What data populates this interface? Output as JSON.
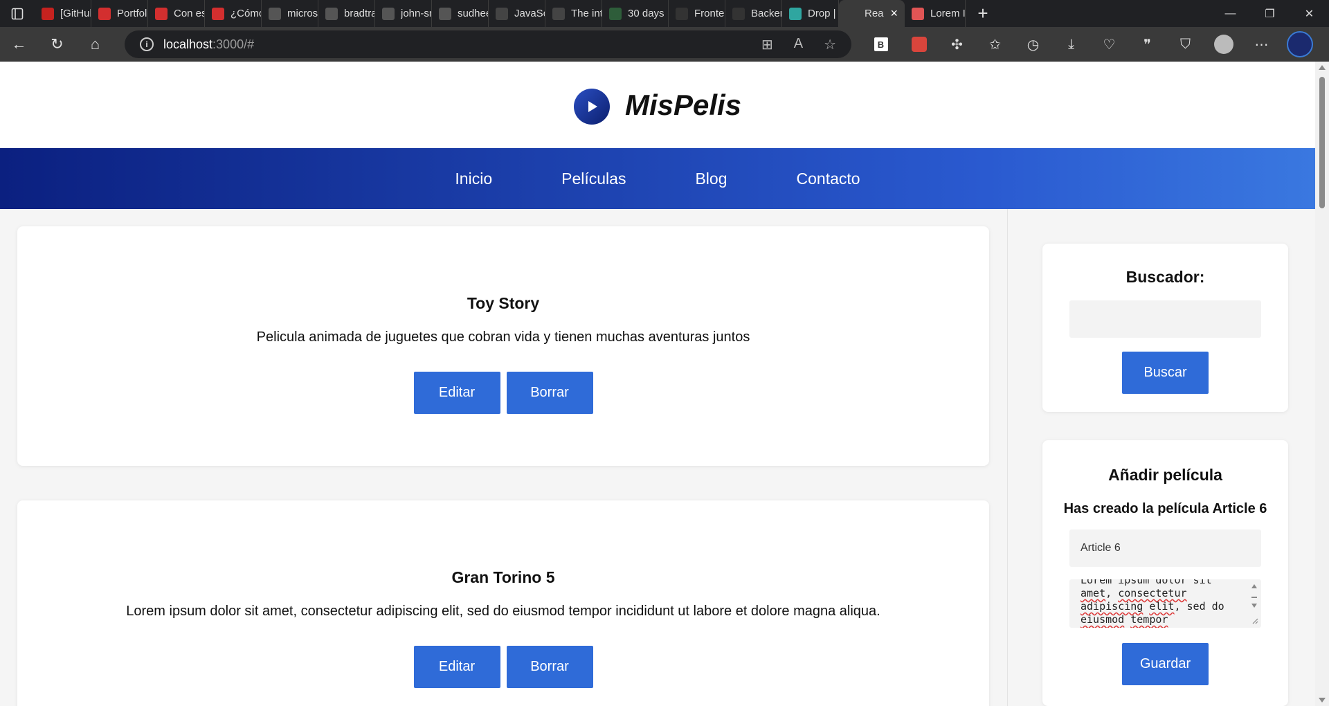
{
  "browser": {
    "tabs": [
      {
        "title": "[GitHub",
        "icon": "gmail-icon",
        "color": "#c5221f"
      },
      {
        "title": "Portfolio",
        "icon": "youtube-icon",
        "color": "#d32f2f"
      },
      {
        "title": "Con est",
        "icon": "youtube-icon",
        "color": "#d32f2f"
      },
      {
        "title": "¿Cómo",
        "icon": "youtube-icon",
        "color": "#d32f2f"
      },
      {
        "title": "microso",
        "icon": "github-icon",
        "color": "#555555"
      },
      {
        "title": "bradtra",
        "icon": "github-icon",
        "color": "#555555"
      },
      {
        "title": "john-sm",
        "icon": "github-icon",
        "color": "#555555"
      },
      {
        "title": "sudheer",
        "icon": "github-icon",
        "color": "#555555"
      },
      {
        "title": "JavaScri",
        "icon": "30-icon",
        "color": "#444444"
      },
      {
        "title": "The inte",
        "icon": "u-icon",
        "color": "#444444"
      },
      {
        "title": "30 days",
        "icon": "n-icon",
        "color": "#2e5d3a"
      },
      {
        "title": "Fronten",
        "icon": "r-icon",
        "color": "#333333"
      },
      {
        "title": "Backen",
        "icon": "r-icon",
        "color": "#333333"
      },
      {
        "title": "Drop | N",
        "icon": "diamond-icon",
        "color": "#2fa6a0"
      },
      {
        "title": "Rea",
        "icon": "react-icon",
        "color": "#3a3a3a",
        "active": true
      },
      {
        "title": "Lorem I",
        "icon": "lorem-icon",
        "color": "#e05555"
      }
    ],
    "url_host": "localhost",
    "url_path": ":3000/#"
  },
  "site": {
    "brand": "MisPelis",
    "nav": [
      "Inicio",
      "Películas",
      "Blog",
      "Contacto"
    ]
  },
  "articles": [
    {
      "title": "Toy Story",
      "description": "Pelicula animada de juguetes que cobran vida y tienen muchas aventuras juntos",
      "edit_label": "Editar",
      "delete_label": "Borrar"
    },
    {
      "title": "Gran Torino 5",
      "description": "Lorem ipsum dolor sit amet, consectetur adipiscing elit, sed do eiusmod tempor incididunt ut labore et dolore magna aliqua.",
      "edit_label": "Editar",
      "delete_label": "Borrar"
    }
  ],
  "search": {
    "heading": "Buscador:",
    "value": "",
    "button": "Buscar"
  },
  "add_movie": {
    "heading": "Añadir película",
    "status": "Has creado la película Article 6",
    "title_value": "Article 6",
    "description_lines": [
      "Lorem ipsum dolor sit",
      "amet, consectetur",
      "adipiscing elit, sed do",
      "eiusmod tempor"
    ],
    "button": "Guardar"
  }
}
